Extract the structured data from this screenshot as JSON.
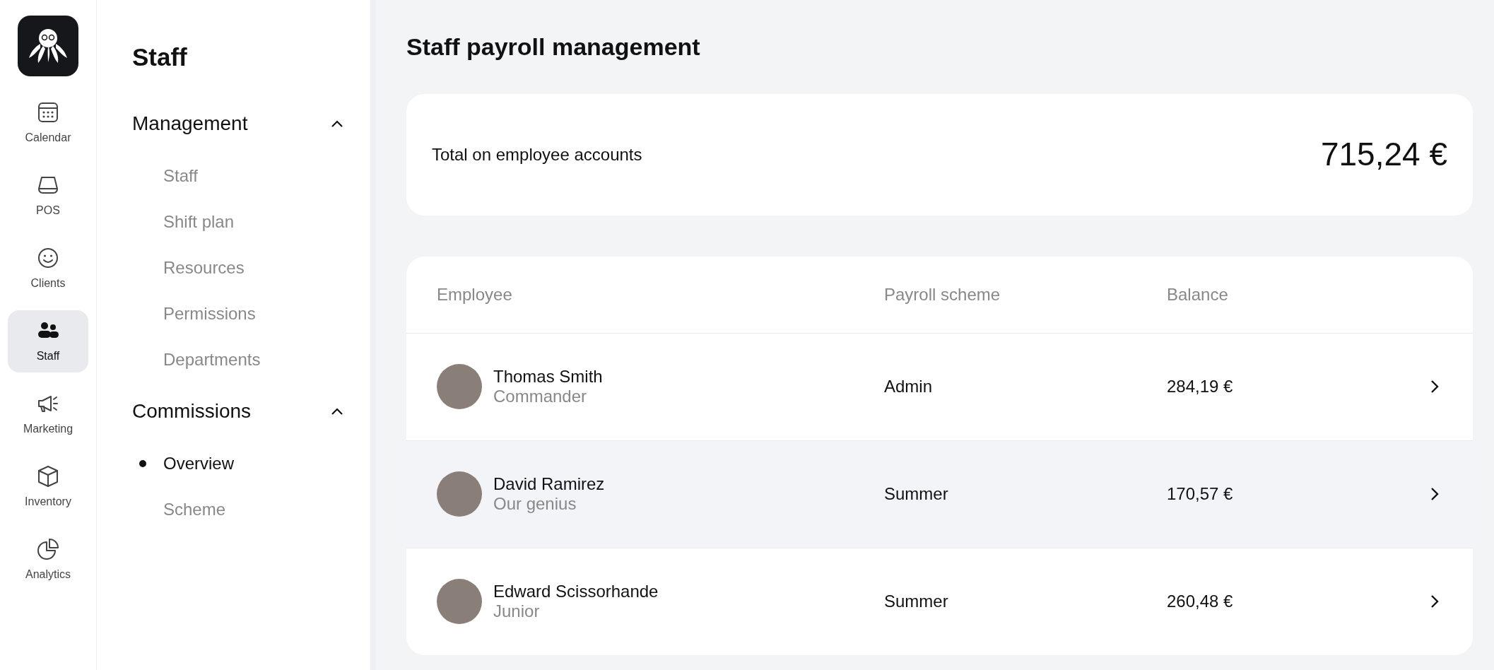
{
  "rail": {
    "items": [
      {
        "label": "Calendar",
        "selected": false
      },
      {
        "label": "POS",
        "selected": false
      },
      {
        "label": "Clients",
        "selected": false
      },
      {
        "label": "Staff",
        "selected": true
      },
      {
        "label": "Marketing",
        "selected": false
      },
      {
        "label": "Inventory",
        "selected": false
      },
      {
        "label": "Analytics",
        "selected": false
      }
    ]
  },
  "sidebar": {
    "title": "Staff",
    "groups": [
      {
        "label": "Management",
        "expanded": true,
        "items": [
          {
            "label": "Staff",
            "selected": false
          },
          {
            "label": "Shift plan",
            "selected": false
          },
          {
            "label": "Resources",
            "selected": false
          },
          {
            "label": "Permissions",
            "selected": false
          },
          {
            "label": "Departments",
            "selected": false
          }
        ]
      },
      {
        "label": "Commissions",
        "expanded": true,
        "items": [
          {
            "label": "Overview",
            "selected": true
          },
          {
            "label": "Scheme",
            "selected": false
          }
        ]
      }
    ]
  },
  "page_title": "Staff payroll management",
  "summary": {
    "label": "Total on employee accounts",
    "value": "715,24 €"
  },
  "table": {
    "columns": [
      "Employee",
      "Payroll scheme",
      "Balance"
    ],
    "rows": [
      {
        "name": "Thomas Smith",
        "role": "Commander",
        "scheme": "Admin",
        "balance": "284,19 €",
        "selected": false
      },
      {
        "name": "David Ramirez",
        "role": "Our genius",
        "scheme": "Summer",
        "balance": "170,57 €",
        "selected": true
      },
      {
        "name": "Edward Scissorhande",
        "role": "Junior",
        "scheme": "Summer",
        "balance": "260,48 €",
        "selected": false
      }
    ]
  }
}
